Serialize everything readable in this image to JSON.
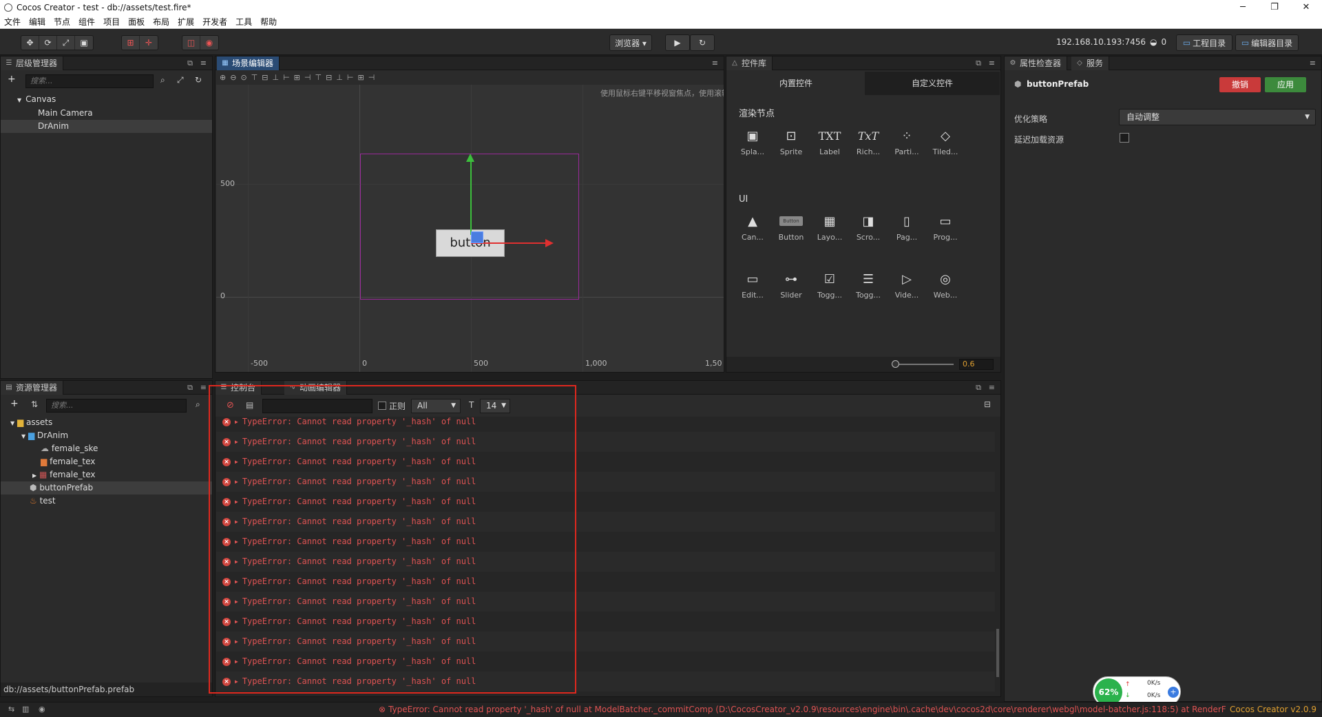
{
  "window": {
    "title": "Cocos Creator - test - db://assets/test.fire*",
    "controls": [
      "─",
      "❐",
      "✕"
    ]
  },
  "menu": [
    "文件",
    "编辑",
    "节点",
    "组件",
    "项目",
    "面板",
    "布局",
    "扩展",
    "开发者",
    "工具",
    "帮助"
  ],
  "toolbar": {
    "preview_label": "浏览器 ▾",
    "ip": "192.168.10.193:7456",
    "ip_count": "0",
    "project_dir": "工程目录",
    "editor_dir": "编辑器目录"
  },
  "hierarchy": {
    "title": "层级管理器",
    "search_placeholder": "搜索...",
    "items": [
      {
        "label": "Canvas",
        "depth": 0,
        "expanded": true
      },
      {
        "label": "Main Camera",
        "depth": 1
      },
      {
        "label": "DrAnim",
        "depth": 1,
        "selected": true
      }
    ]
  },
  "scene": {
    "title": "场景编辑器",
    "hint": "使用鼠标右键平移视窗焦点，使用滚轮缩放视图",
    "button_text": "button",
    "y_labels": [
      "500",
      "0"
    ],
    "x_labels": [
      "-500",
      "0",
      "500",
      "1,000",
      "1,50"
    ]
  },
  "library": {
    "title": "控件库",
    "tabs": [
      "内置控件",
      "自定义控件"
    ],
    "render_section": "渲染节点",
    "render_items": [
      {
        "label": "Spla...",
        "icon": "splash-icon"
      },
      {
        "label": "Sprite",
        "icon": "sprite-icon"
      },
      {
        "label": "Label",
        "icon": "label-icon",
        "glyph": "TXT"
      },
      {
        "label": "Rich...",
        "icon": "richtext-icon",
        "glyph": "TxT"
      },
      {
        "label": "Parti...",
        "icon": "particle-icon"
      },
      {
        "label": "Tiled...",
        "icon": "tiledmap-icon"
      }
    ],
    "ui_section": "UI",
    "ui_items_row1": [
      {
        "label": "Can...",
        "icon": "canvas-icon"
      },
      {
        "label": "Button",
        "icon": "button-icon",
        "glyph": "Button"
      },
      {
        "label": "Layo...",
        "icon": "layout-icon"
      },
      {
        "label": "Scro...",
        "icon": "scrollview-icon"
      },
      {
        "label": "Pag...",
        "icon": "pageview-icon"
      },
      {
        "label": "Prog...",
        "icon": "progressbar-icon"
      }
    ],
    "ui_items_row2": [
      {
        "label": "Edit...",
        "icon": "editbox-icon"
      },
      {
        "label": "Slider",
        "icon": "slider-icon"
      },
      {
        "label": "Togg...",
        "icon": "toggle-icon"
      },
      {
        "label": "Togg...",
        "icon": "togglegroup-icon"
      },
      {
        "label": "Vide...",
        "icon": "videoplayer-icon"
      },
      {
        "label": "Web...",
        "icon": "webview-icon"
      }
    ],
    "zoom_value": "0.6"
  },
  "inspector": {
    "tabs": [
      "属性检查器",
      "服务"
    ],
    "node_name": "buttonPrefab",
    "revert_label": "撤销",
    "apply_label": "应用",
    "opt_label": "优化策略",
    "opt_value": "自动调整",
    "lazy_label": "延迟加载资源"
  },
  "assets": {
    "title": "资源管理器",
    "search_placeholder": "搜索...",
    "items": [
      {
        "label": "assets",
        "depth": 0
      },
      {
        "label": "DrAnim",
        "depth": 1
      },
      {
        "label": "female_ske",
        "depth": 2
      },
      {
        "label": "female_tex",
        "depth": 2
      },
      {
        "label": "female_tex",
        "depth": 2
      },
      {
        "label": "buttonPrefab",
        "depth": 0,
        "selected": true
      },
      {
        "label": "test",
        "depth": 0
      }
    ],
    "footer_path": "db://assets/buttonPrefab.prefab"
  },
  "console": {
    "tabs": [
      "控制台",
      "动画编辑器"
    ],
    "regex_label": "正则",
    "filter_value": "All",
    "font_size": "14",
    "message": "TypeError: Cannot read property '_hash' of null",
    "row_count": 14
  },
  "statusbar": {
    "error_text": "TypeError: Cannot read property '_hash' of null at ModelBatcher._commitComp (D:\\CocosCreator_v2.0.9\\resources\\engine\\bin\\.cache\\dev\\cocos2d\\core\\renderer\\webgl\\model-batcher.js:118:5) at RenderFlow._proto._render",
    "version": "Cocos Creator v2.0.9"
  },
  "netmeter": {
    "percent": "62%",
    "up": "0K/s",
    "down": "0K/s"
  },
  "colors": {
    "highlight_border": "#e0281e",
    "error_text": "#e05353",
    "accent_blue": "#2a4b74"
  }
}
